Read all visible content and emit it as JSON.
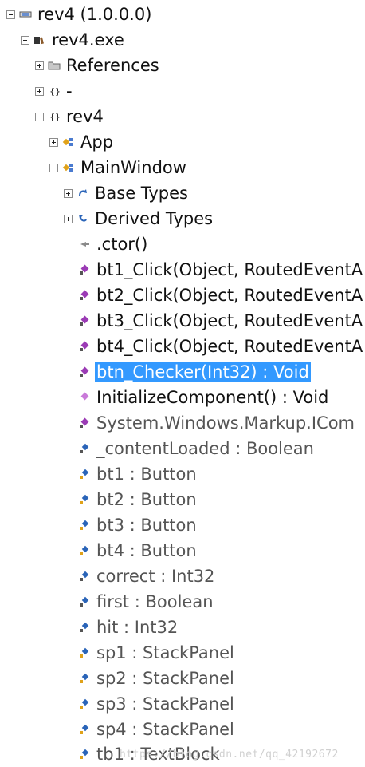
{
  "tree": {
    "assembly": "rev4 (1.0.0.0)",
    "module": "rev4.exe",
    "references": "References",
    "namespace_dash": "-",
    "namespace_rev4": "rev4",
    "class_app": "App",
    "class_mainwindow": "MainWindow",
    "base_types": "Base Types",
    "derived_types": "Derived Types",
    "members": [
      ".ctor()",
      "bt1_Click(Object, RoutedEventA",
      "bt2_Click(Object, RoutedEventA",
      "bt3_Click(Object, RoutedEventA",
      "bt4_Click(Object, RoutedEventA",
      "btn_Checker(Int32) : Void",
      "InitializeComponent() : Void",
      "System.Windows.Markup.ICom",
      "_contentLoaded : Boolean",
      "bt1 : Button",
      "bt2 : Button",
      "bt3 : Button",
      "bt4 : Button",
      "correct : Int32",
      "first : Boolean",
      "hit : Int32",
      "sp1 : StackPanel",
      "sp2 : StackPanel",
      "sp3 : StackPanel",
      "sp4 : StackPanel",
      "tb1 : TextBlock"
    ]
  },
  "watermark": "https://blog.csdn.net/qq_42192672",
  "colors": {
    "selection": "#3399ff",
    "method_icon": "#9b3bb5",
    "field_icon": "#2a64b8",
    "class_icon": "#e0a21a"
  }
}
